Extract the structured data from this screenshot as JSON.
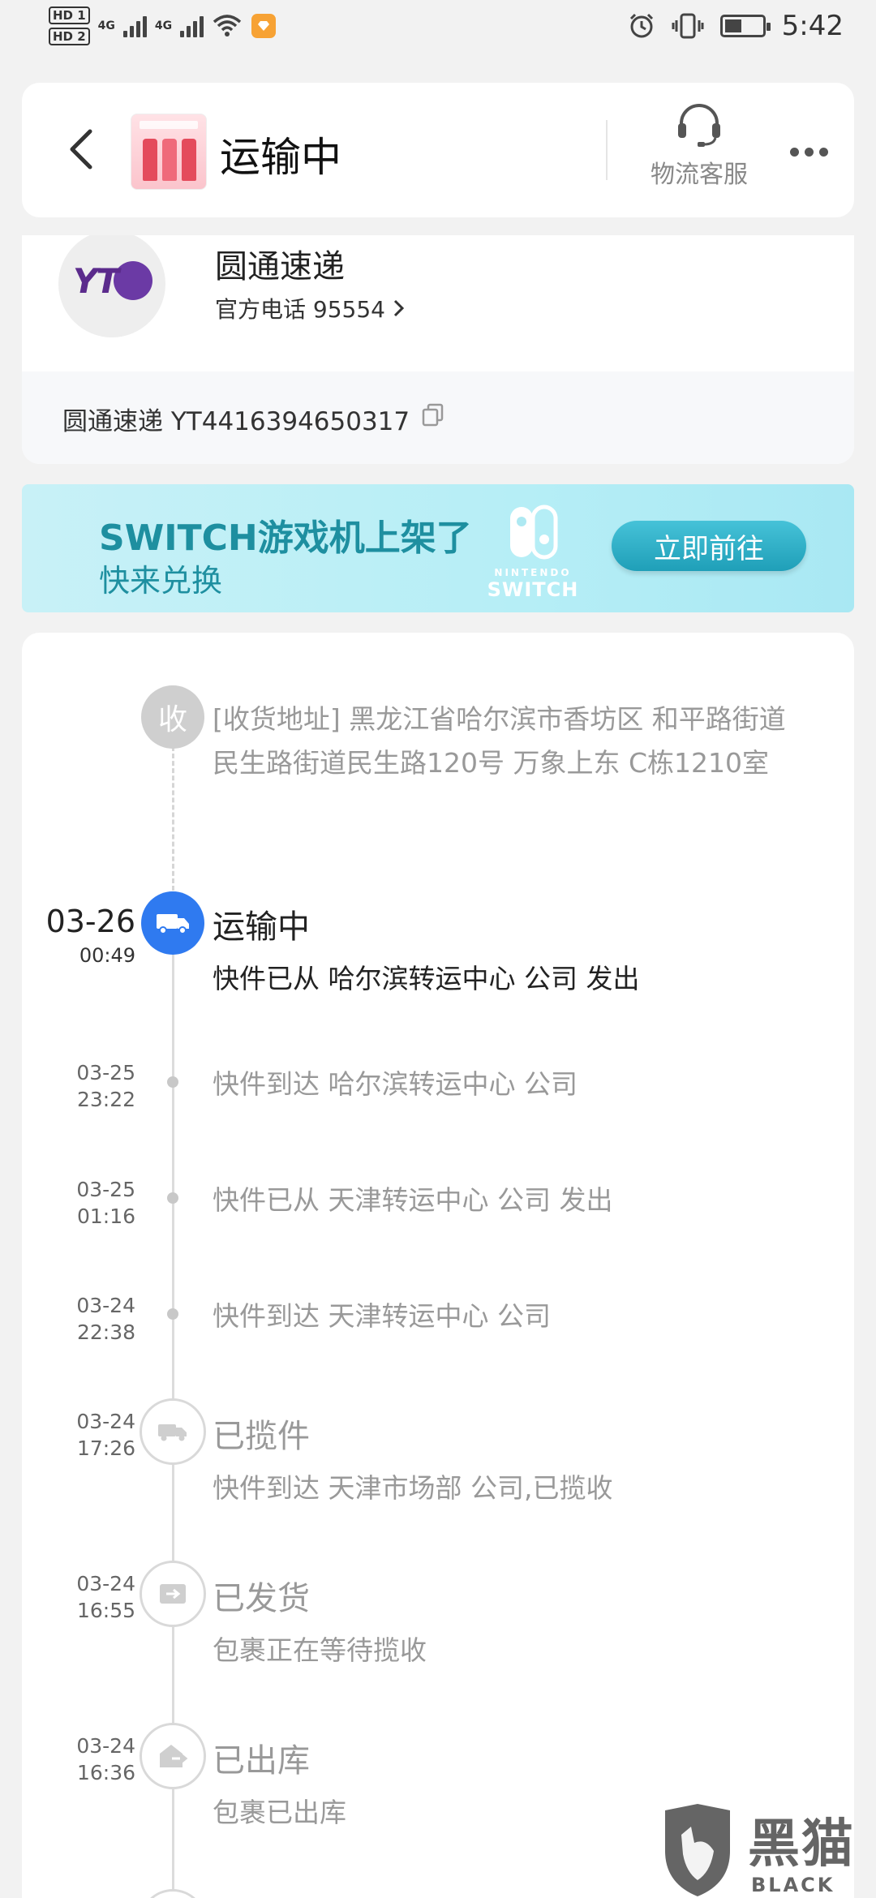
{
  "status_bar": {
    "hd1": "HD 1",
    "hd2": "HD 2",
    "net1": "4G",
    "net2": "4G",
    "time": "5:42",
    "icons": [
      "wifi-icon",
      "notification-app-icon",
      "alarm-icon",
      "vibrate-icon",
      "battery-icon"
    ]
  },
  "header": {
    "title": "运输中",
    "service_label": "物流客服",
    "icons": [
      "back-icon",
      "headset-icon",
      "more-icon"
    ]
  },
  "courier": {
    "logo_text": "YT",
    "name": "圆通速递",
    "phone": "官方电话 95554",
    "tracking": "圆通速递 YT4416394650317"
  },
  "banner": {
    "title": "SWITCH游戏机上架了",
    "subtitle": "快来兑换",
    "brand_small": "NINTENDO",
    "brand": "SWITCH",
    "cta": "立即前往"
  },
  "timeline": {
    "receiver": {
      "badge": "收",
      "address": "[收货地址] 黑龙江省哈尔滨市香坊区 和平路街道　民生路街道民生路120号 万象上东 C栋1210室"
    },
    "events": [
      {
        "date": "03-26",
        "time": "00:49",
        "status": "运输中",
        "desc": "快件已从 哈尔滨转运中心 公司 发出"
      },
      {
        "date": "03-25",
        "time": "23:22",
        "desc": "快件到达 哈尔滨转运中心 公司"
      },
      {
        "date": "03-25",
        "time": "01:16",
        "desc": "快件已从 天津转运中心 公司 发出"
      },
      {
        "date": "03-24",
        "time": "22:38",
        "desc": "快件到达 天津转运中心 公司"
      },
      {
        "date": "03-24",
        "time": "17:26",
        "status": "已揽件",
        "desc": "快件到达 天津市场部 公司,已揽收"
      },
      {
        "date": "03-24",
        "time": "16:55",
        "status": "已发货",
        "desc": "包裹正在等待揽收"
      },
      {
        "date": "03-24",
        "time": "16:36",
        "status": "已出库",
        "desc": "包裹已出库"
      }
    ]
  },
  "watermark": {
    "cn": "黑猫",
    "en": "BLACK CAT"
  },
  "colors": {
    "accent": "#2f7af0",
    "banner_text": "#1e8fa0",
    "muted": "#999999"
  }
}
